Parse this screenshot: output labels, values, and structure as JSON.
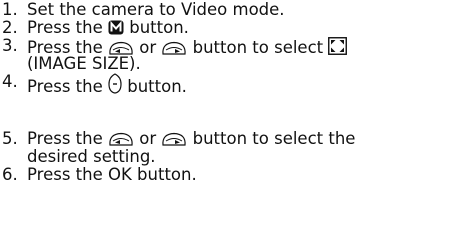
{
  "steps": [
    {
      "number": "1.",
      "lines": [
        [
          "Set the camera to Video mode."
        ]
      ]
    },
    {
      "number": "2.",
      "lines": [
        [
          "Press the ",
          {
            "icon": "menu-m-icon"
          },
          " button."
        ]
      ]
    },
    {
      "number": "3.",
      "lines": [
        [
          "Press the ",
          {
            "icon": "left-arrow-button-icon"
          },
          " or ",
          {
            "icon": "right-arrow-button-icon"
          },
          " button to select ",
          {
            "icon": "image-size-icon"
          }
        ],
        [
          "(IMAGE SIZE)."
        ]
      ]
    },
    {
      "number": "4.",
      "lines": [
        [
          "Press the ",
          {
            "icon": "shutter-button-icon"
          },
          " button."
        ]
      ]
    },
    {
      "number": "5.",
      "lines": [
        [
          "Press the ",
          {
            "icon": "left-arrow-button-icon"
          },
          " or ",
          {
            "icon": "right-arrow-button-icon"
          },
          " button to select the"
        ],
        [
          "desired setting."
        ]
      ]
    },
    {
      "number": "6.",
      "lines": [
        [
          "Press the OK button."
        ]
      ]
    }
  ]
}
